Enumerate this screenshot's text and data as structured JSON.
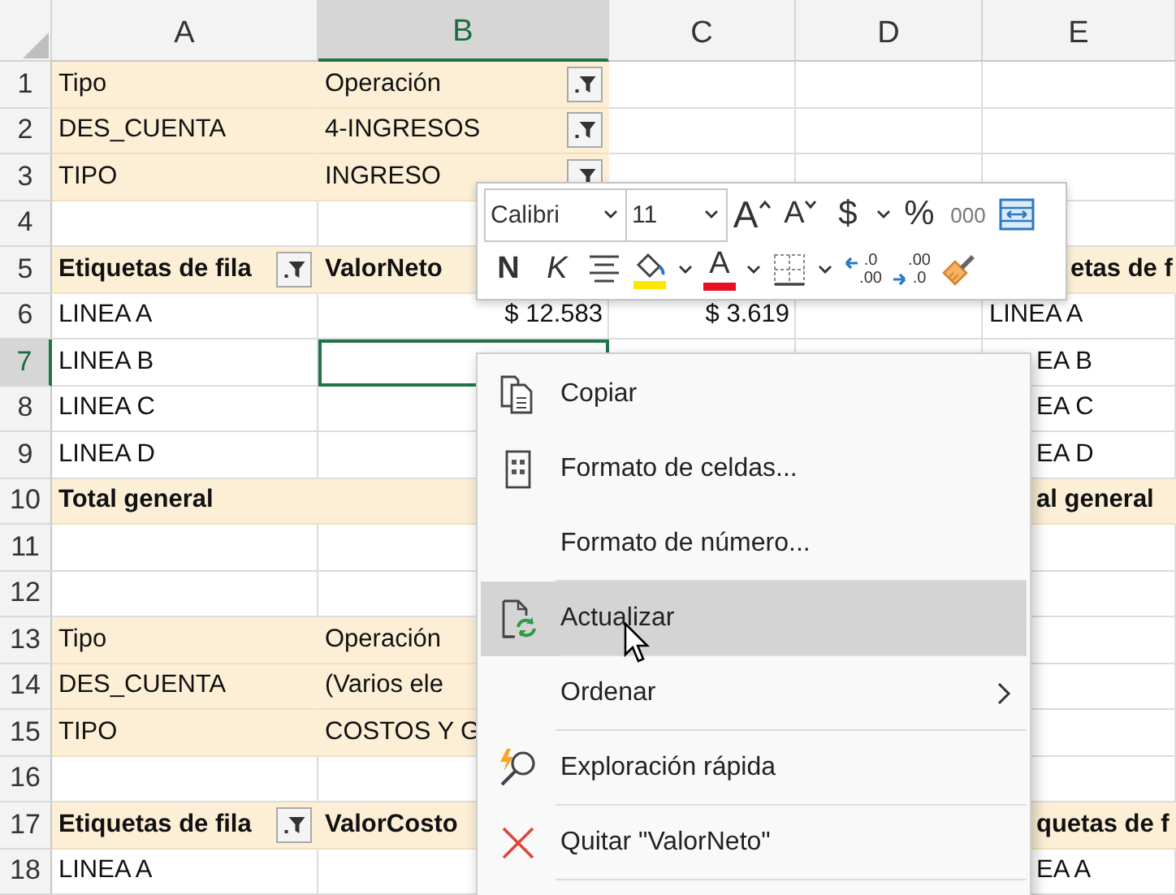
{
  "columns": [
    {
      "label": "A",
      "selected": false
    },
    {
      "label": "B",
      "selected": true
    },
    {
      "label": "C",
      "selected": false
    },
    {
      "label": "D",
      "selected": false
    },
    {
      "label": "E",
      "selected": false
    }
  ],
  "rows": [
    {
      "label": "1",
      "selected": false,
      "cells": [
        {
          "kind": "text",
          "text": "Tipo",
          "shaded": true
        },
        {
          "kind": "text",
          "text": "Operación",
          "shaded": true,
          "filter": true
        },
        {
          "shaded": false
        },
        {
          "shaded": false
        },
        {
          "shaded": false
        }
      ]
    },
    {
      "label": "2",
      "selected": false,
      "cells": [
        {
          "kind": "text",
          "text": "DES_CUENTA",
          "shaded": true
        },
        {
          "kind": "text",
          "text": "4-INGRESOS",
          "shaded": true,
          "filter": true
        },
        {
          "shaded": false
        },
        {
          "shaded": false
        },
        {
          "shaded": false
        }
      ]
    },
    {
      "label": "3",
      "selected": false,
      "cells": [
        {
          "kind": "text",
          "text": "TIPO",
          "shaded": true
        },
        {
          "kind": "text",
          "text": "INGRESO",
          "shaded": true,
          "filter": true
        },
        {
          "shaded": false
        },
        {
          "shaded": false
        },
        {
          "shaded": false
        }
      ]
    },
    {
      "label": "4",
      "selected": false,
      "cells": [
        {
          "shaded": false
        },
        {
          "shaded": false
        },
        {},
        {},
        {
          "shaded": false
        }
      ]
    },
    {
      "label": "5",
      "selected": false,
      "cells": [
        {
          "kind": "text",
          "text": "Etiquetas de fila",
          "shaded": true,
          "bold": true,
          "filter": true
        },
        {
          "kind": "text",
          "text": "ValorNeto",
          "shaded": true,
          "bold": true
        },
        {},
        {},
        {
          "kind": "text",
          "text": "etas de f",
          "shaded": true,
          "bold": true
        }
      ]
    },
    {
      "label": "6",
      "selected": false,
      "cells": [
        {
          "kind": "text",
          "text": "LINEA A",
          "shaded": false
        },
        {
          "kind": "number",
          "text": "$ 12.583",
          "shaded": false
        },
        {
          "kind": "number",
          "text": "$ 3.619",
          "shaded": false
        },
        {
          "shaded": false
        },
        {
          "kind": "text",
          "text": "LINEA A",
          "shaded": false
        }
      ]
    },
    {
      "label": "7",
      "selected": true,
      "cells": [
        {
          "kind": "text",
          "text": "LINEA B",
          "shaded": false
        },
        {
          "shaded": false
        },
        {},
        {},
        {
          "kind": "text",
          "text": "EA B",
          "shaded": false
        }
      ]
    },
    {
      "label": "8",
      "selected": false,
      "cells": [
        {
          "kind": "text",
          "text": "LINEA C",
          "shaded": false
        },
        {
          "shaded": false
        },
        {},
        {},
        {
          "kind": "text",
          "text": "EA C",
          "shaded": false
        }
      ]
    },
    {
      "label": "9",
      "selected": false,
      "cells": [
        {
          "kind": "text",
          "text": "LINEA D",
          "shaded": false
        },
        {
          "shaded": false
        },
        {},
        {},
        {
          "kind": "text",
          "text": "EA D",
          "shaded": false
        }
      ]
    },
    {
      "label": "10",
      "selected": false,
      "cells": [
        {
          "kind": "text",
          "text": "Total general",
          "shaded": true,
          "bold": true
        },
        {
          "shaded": true
        },
        {},
        {},
        {
          "kind": "text",
          "text": "al general",
          "shaded": true,
          "bold": true
        }
      ]
    },
    {
      "label": "11",
      "selected": false,
      "cells": [
        {
          "shaded": false
        },
        {
          "shaded": false
        },
        {},
        {},
        {
          "shaded": false
        }
      ]
    },
    {
      "label": "12",
      "selected": false,
      "cells": [
        {
          "shaded": false
        },
        {
          "shaded": false
        },
        {},
        {},
        {
          "shaded": false
        }
      ]
    },
    {
      "label": "13",
      "selected": false,
      "cells": [
        {
          "kind": "text",
          "text": "Tipo",
          "shaded": true
        },
        {
          "kind": "text",
          "text": "Operación",
          "shaded": true
        },
        {},
        {},
        {
          "shaded": false
        }
      ]
    },
    {
      "label": "14",
      "selected": false,
      "cells": [
        {
          "kind": "text",
          "text": "DES_CUENTA",
          "shaded": true
        },
        {
          "kind": "text",
          "text": "(Varios ele",
          "shaded": true
        },
        {},
        {},
        {
          "shaded": false
        }
      ]
    },
    {
      "label": "15",
      "selected": false,
      "cells": [
        {
          "kind": "text",
          "text": "TIPO",
          "shaded": true
        },
        {
          "kind": "text",
          "text": "COSTOS Y G",
          "shaded": true
        },
        {},
        {},
        {
          "shaded": false
        }
      ]
    },
    {
      "label": "16",
      "selected": false,
      "cells": [
        {
          "shaded": false
        },
        {
          "shaded": false
        },
        {},
        {},
        {
          "shaded": false
        }
      ]
    },
    {
      "label": "17",
      "selected": false,
      "cells": [
        {
          "kind": "text",
          "text": "Etiquetas de fila",
          "shaded": true,
          "bold": true,
          "filter": true
        },
        {
          "kind": "text",
          "text": "ValorCosto",
          "shaded": true,
          "bold": true
        },
        {},
        {},
        {
          "kind": "text",
          "text": "quetas de f",
          "shaded": true,
          "bold": true
        }
      ]
    },
    {
      "label": "18",
      "selected": false,
      "cells": [
        {
          "kind": "text",
          "text": "LINEA A",
          "shaded": false
        },
        {
          "shaded": false
        },
        {},
        {},
        {
          "kind": "text",
          "text": "EA A",
          "shaded": false
        }
      ]
    }
  ],
  "mini_toolbar": {
    "font": "Calibri",
    "size": "11",
    "row_1": [
      {
        "kind": "grow-font",
        "label": "A"
      },
      {
        "kind": "shrink-font",
        "label": "A"
      },
      {
        "kind": "currency",
        "label": "$"
      },
      {
        "kind": "dropdown"
      },
      {
        "kind": "percent",
        "label": "%"
      },
      {
        "kind": "thousands",
        "label": "000"
      },
      {
        "kind": "wrap"
      }
    ],
    "row_2": [
      {
        "kind": "bold",
        "label": "N"
      },
      {
        "kind": "italic",
        "label": "K"
      },
      {
        "kind": "align"
      },
      {
        "kind": "fill-color",
        "color": "#ffe600"
      },
      {
        "kind": "dropdown"
      },
      {
        "kind": "font-color",
        "label": "A",
        "color": "#e81123"
      },
      {
        "kind": "dropdown"
      },
      {
        "kind": "borders"
      },
      {
        "kind": "dropdown"
      },
      {
        "kind": "increase-decimal",
        "label": ".0",
        "label_2": ".00"
      },
      {
        "kind": "decrease-decimal",
        "label": ".00",
        "label_2": ".0"
      },
      {
        "kind": "format-painter"
      }
    ]
  },
  "context_menu": {
    "items": [
      {
        "label": "Copiar",
        "kind": "copy",
        "selected": false,
        "divider": false,
        "submenu": false
      },
      {
        "label": "Formato de celdas...",
        "kind": "format-cells",
        "selected": false,
        "divider": false,
        "submenu": false
      },
      {
        "label": "Formato de número...",
        "kind": "plain",
        "selected": false,
        "divider": true,
        "submenu": false
      },
      {
        "label": "Actualizar",
        "kind": "refresh",
        "selected": true,
        "divider": true,
        "submenu": false
      },
      {
        "label": "Ordenar",
        "kind": "plain",
        "selected": false,
        "divider": true,
        "submenu": true
      },
      {
        "label": "Exploración rápida",
        "kind": "quick-analysis",
        "selected": false,
        "divider": true,
        "submenu": false
      },
      {
        "label": "Quitar \"ValorNeto\"",
        "kind": "remove",
        "selected": false,
        "divider": true,
        "submenu": false
      }
    ]
  }
}
